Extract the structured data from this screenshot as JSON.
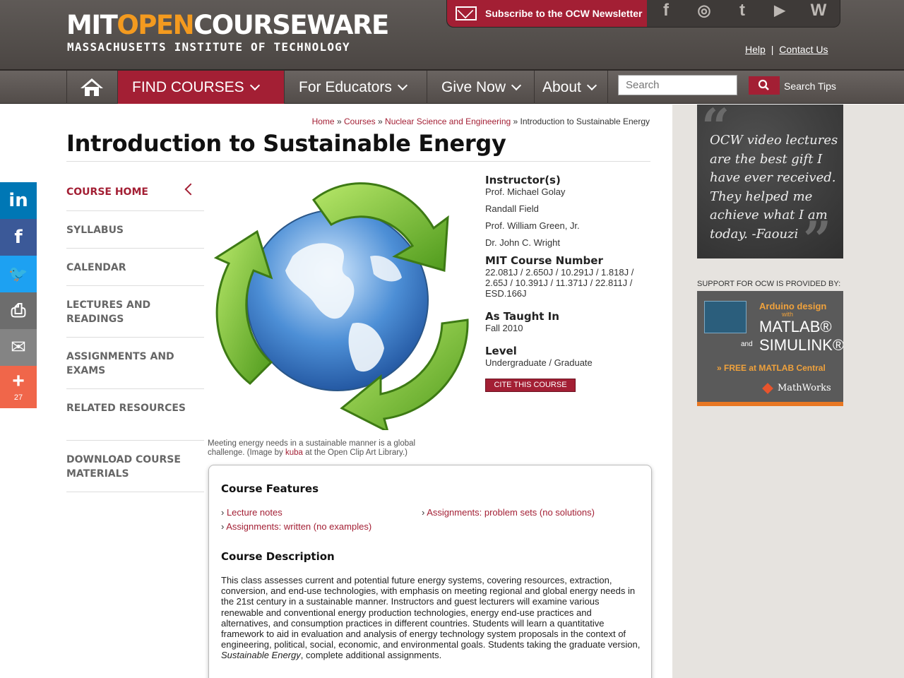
{
  "header": {
    "logo_mit": "MIT",
    "logo_open": "OPEN",
    "logo_courseware": "COURSEWARE",
    "logo_sub": "MASSACHUSETTS INSTITUTE OF TECHNOLOGY",
    "newsletter": "Subscribe to the OCW Newsletter",
    "social": [
      "f",
      "◎",
      "t",
      "▶",
      "W"
    ],
    "help": "Help",
    "separator": "|",
    "contact": "Contact Us"
  },
  "nav": {
    "find_courses": "FIND COURSES",
    "for_educators": "For Educators",
    "give_now": "Give Now",
    "about": "About",
    "search_placeholder": "Search",
    "search_tips": "Search Tips"
  },
  "breadcrumb": {
    "home": "Home",
    "courses": "Courses",
    "dept": "Nuclear Science and Engineering",
    "current": "Introduction to Sustainable Energy",
    "sep": "»"
  },
  "page_title": "Introduction to Sustainable Energy",
  "share": [
    {
      "glyph": "in",
      "color": "#0077b5"
    },
    {
      "glyph": "f",
      "color": "#3b5998"
    },
    {
      "glyph": "🐦",
      "color": "#1da1f2"
    },
    {
      "glyph": "⎙",
      "color": "#6d6d6d"
    },
    {
      "glyph": "✉",
      "color": "#848484"
    },
    {
      "glyph": "+",
      "color": "#f0664a",
      "count": "27"
    }
  ],
  "course_nav": [
    "COURSE HOME",
    "SYLLABUS",
    "CALENDAR",
    "LECTURES AND READINGS",
    "ASSIGNMENTS AND EXAMS",
    "RELATED RESOURCES",
    "DOWNLOAD COURSE MATERIALS"
  ],
  "caption": {
    "text": "Meeting energy needs in a sustainable manner is a global challenge. (Image by ",
    "link": "kuba",
    "after": " at the Open Clip Art Library.)"
  },
  "info": {
    "instructors_label": "Instructor(s)",
    "instructors": [
      "Prof. Michael Golay",
      "Randall Field",
      "Prof. William Green, Jr.",
      "Dr. John C. Wright"
    ],
    "course_number_label": "MIT Course Number",
    "course_number": "22.081J / 2.650J / 10.291J / 1.818J / 2.65J / 10.391J / 11.371J / 22.811J / ESD.166J",
    "taught_label": "As Taught In",
    "taught": "Fall 2010",
    "level_label": "Level",
    "level": "Undergraduate / Graduate",
    "cite": "CITE THIS COURSE"
  },
  "features": {
    "title": "Course Features",
    "links": [
      "Lecture notes",
      "Assignments: problem sets (no solutions)",
      "Assignments: written (no examples)"
    ],
    "desc_title": "Course Description",
    "desc_main": "This class assesses current and potential future energy systems, covering resources, extraction, conversion, and end-use technologies, with emphasis on meeting regional and global energy needs in the 21st century in a sustainable manner. Instructors and guest lecturers will examine various renewable and conventional energy production technologies, energy end-use practices and alternatives, and consumption practices in different countries. Students will learn a quantitative framework to aid in evaluation and analysis of energy technology system proposals in the context of engineering, political, social, economic, and environmental goals. Students taking the graduate version, ",
    "desc_italic": "Sustainable Energy",
    "desc_end": ", complete additional assignments."
  },
  "sidebar": {
    "quote": "OCW video lectures are the best gift I have ever received. They helped me achieve what I am today. -Faouzi",
    "support_label": "SUPPORT FOR OCW IS PROVIDED BY:",
    "ad_line1": "Arduino design",
    "ad_with": "with",
    "ad_matlab": "MATLAB®",
    "ad_and": "and",
    "ad_simulink": "SIMULINK®",
    "ad_free": "» FREE at MATLAB Central",
    "ad_brand": "MathWorks"
  },
  "colors": {
    "accent": "#a31f34",
    "header": "#4b4643",
    "orange": "#f39a1f"
  }
}
